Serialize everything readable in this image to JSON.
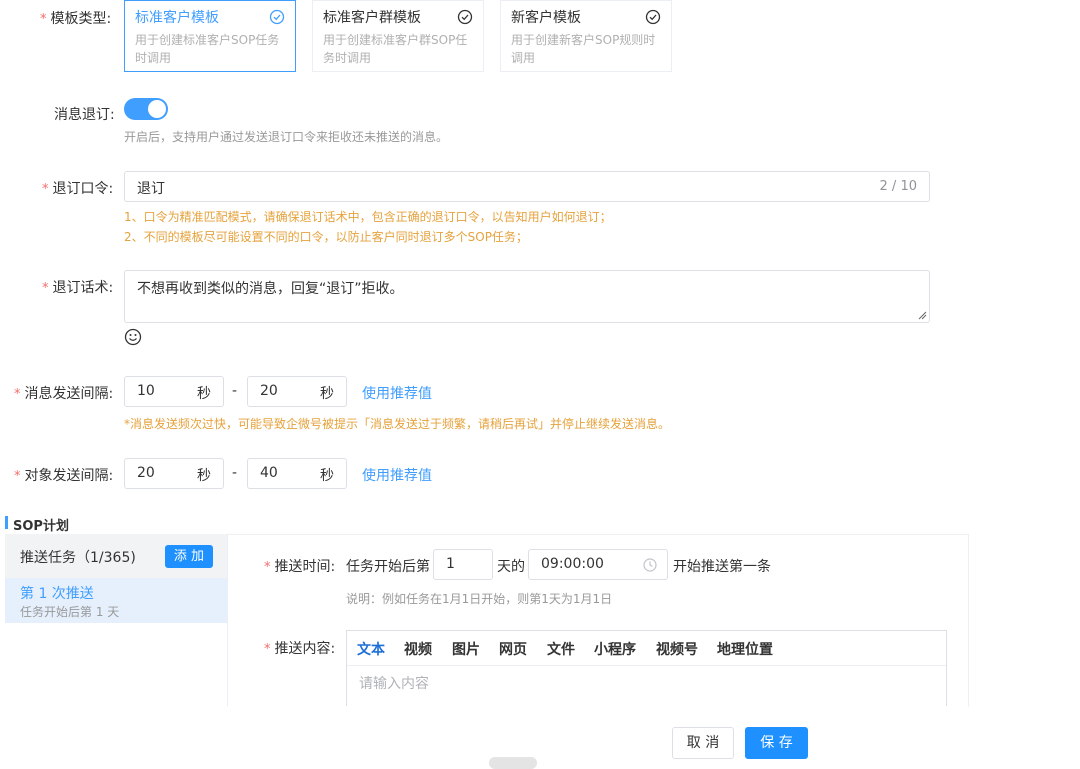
{
  "template_type": {
    "label": "模板类型:",
    "cards": [
      {
        "title": "标准客户模板",
        "desc": "用于创建标准客户SOP任务时调用",
        "selected": true
      },
      {
        "title": "标准客户群模板",
        "desc": "用于创建标准客户群SOP任务时调用",
        "selected": false
      },
      {
        "title": "新客户模板",
        "desc": "用于创建新客户SOP规则时调用",
        "selected": false
      }
    ]
  },
  "unsubscribe": {
    "label": "消息退订:",
    "enabled": true,
    "hint": "开启后，支持用户通过发送退订口令来拒收还未推送的消息。"
  },
  "keyword": {
    "label": "退订口令:",
    "value": "退订",
    "counter": "2 / 10",
    "tips": [
      "1、口令为精准匹配模式，请确保退订话术中，包含正确的退订口令，以告知用户如何退订；",
      "2、不同的模板尽可能设置不同的口令，以防止客户同时退订多个SOP任务；"
    ]
  },
  "script": {
    "label": "退订话术:",
    "value": "不想再收到类似的消息，回复“退订”拒收。",
    "emoji_icon": "smiley-icon"
  },
  "msg_interval": {
    "label": "消息发送间隔:",
    "min": "10",
    "max": "20",
    "unit": "秒",
    "dash": "-",
    "recommend": "使用推荐值",
    "warning": "*消息发送频次过快，可能导致企微号被提示「消息发送过于频繁，请稍后再试」并停止继续发送消息。"
  },
  "obj_interval": {
    "label": "对象发送间隔:",
    "min": "20",
    "max": "40",
    "unit": "秒",
    "dash": "-",
    "recommend": "使用推荐值"
  },
  "sop": {
    "title": "SOP计划",
    "task_header": "推送任务（1/365)",
    "add_label": "添 加",
    "tasks": [
      {
        "name": "第 1 次推送",
        "sub": "任务开始后第 1 天"
      }
    ],
    "push_time": {
      "label": "推送时间:",
      "prefix": "任务开始后第",
      "day": "1",
      "day_suffix": "天的",
      "time": "09:00:00",
      "suffix": "开始推送第一条",
      "note": "说明：例如任务在1月1日开始，则第1天为1月1日"
    },
    "push_content": {
      "label": "推送内容:",
      "tabs": [
        "文本",
        "视频",
        "图片",
        "网页",
        "文件",
        "小程序",
        "视频号",
        "地理位置"
      ],
      "active_tab": "文本",
      "placeholder": "请输入内容"
    }
  },
  "footer": {
    "cancel": "取 消",
    "save": "保 存"
  },
  "colors": {
    "primary": "#409eff",
    "warning": "#e6a23c",
    "required": "#f56c6c"
  }
}
